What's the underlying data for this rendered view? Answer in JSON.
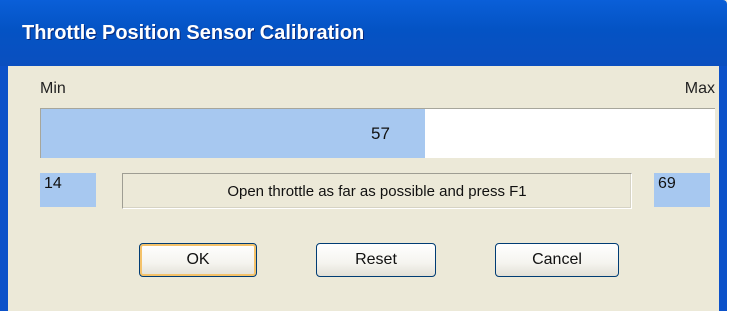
{
  "window": {
    "title": "Throttle Position Sensor Calibration"
  },
  "calibration": {
    "min_label": "Min",
    "max_label": "Max",
    "current_value": "57",
    "current_fraction": 0.57,
    "min_value": "14",
    "max_value": "69",
    "instruction": "Open throttle as far as possible and press F1"
  },
  "buttons": {
    "ok": "OK",
    "reset": "Reset",
    "cancel": "Cancel"
  },
  "colors": {
    "titlebar": "#0453c4",
    "bar_fill": "#a7c8f0",
    "dialog_bg": "#ece9d8"
  }
}
